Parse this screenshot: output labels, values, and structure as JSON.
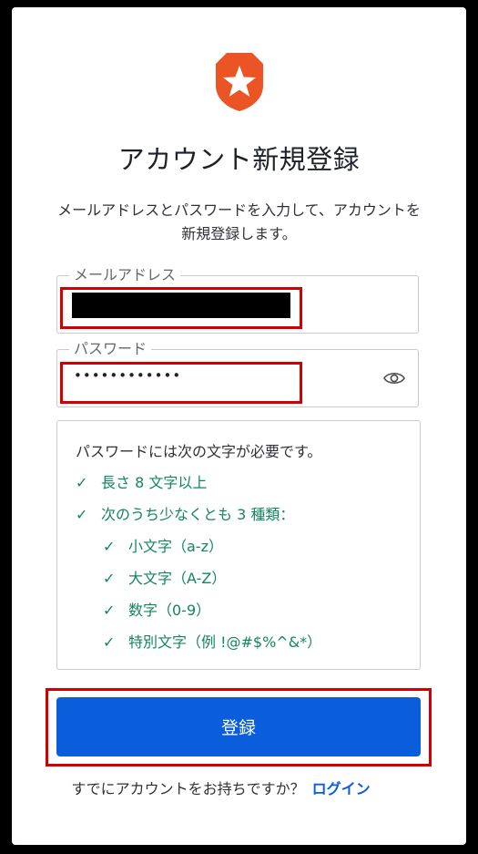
{
  "brand": {
    "logo": "auth0-shield-star-icon",
    "logo_color": "#eb5424"
  },
  "page": {
    "title": "アカウント新規登録",
    "description": "メールアドレスとパスワードを入力して、アカウントを新規登録します。"
  },
  "form": {
    "email": {
      "label": "メールアドレス",
      "value": ""
    },
    "password": {
      "label": "パスワード",
      "value": "••••••••••••",
      "toggle_icon": "eye-icon"
    }
  },
  "password_rules": {
    "header": "パスワードには次の文字が必要です。",
    "items": [
      {
        "check": "✓",
        "text": "長さ 8 文字以上"
      },
      {
        "check": "✓",
        "text": "次のうち少なくとも 3 種類："
      },
      {
        "check": "✓",
        "text": "小文字（a-z）"
      },
      {
        "check": "✓",
        "text": "大文字（A-Z）"
      },
      {
        "check": "✓",
        "text": "数字（0-9）"
      },
      {
        "check": "✓",
        "text": "特別文字（例 !@#$%^&*）"
      }
    ],
    "color": "#13855f"
  },
  "actions": {
    "submit_label": "登録",
    "submit_color": "#0a5ddb"
  },
  "footer": {
    "prompt": "すでにアカウントをお持ちですか？",
    "login_link": "ログイン"
  }
}
